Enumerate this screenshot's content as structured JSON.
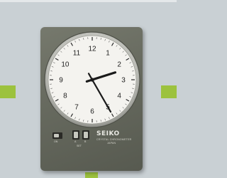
{
  "dial": {
    "numerals": [
      "12",
      "1",
      "2",
      "3",
      "4",
      "5",
      "6",
      "7",
      "8",
      "9",
      "10",
      "11"
    ],
    "time": {
      "hour": 2,
      "minute": 25
    }
  },
  "plate": {
    "brand": "SEIKO",
    "line1": "CRYSTAL CHRONOMETER",
    "line2": "JAPAN"
  },
  "controls": {
    "left_label": "ON",
    "mid_label_a": "A",
    "mid_label_b": "B",
    "mid_caption": "SET"
  },
  "colors": {
    "accent": "#9cc23e",
    "body": "#676a5f",
    "dial": "#f4f3ef",
    "hands": "#1a1a1a"
  }
}
